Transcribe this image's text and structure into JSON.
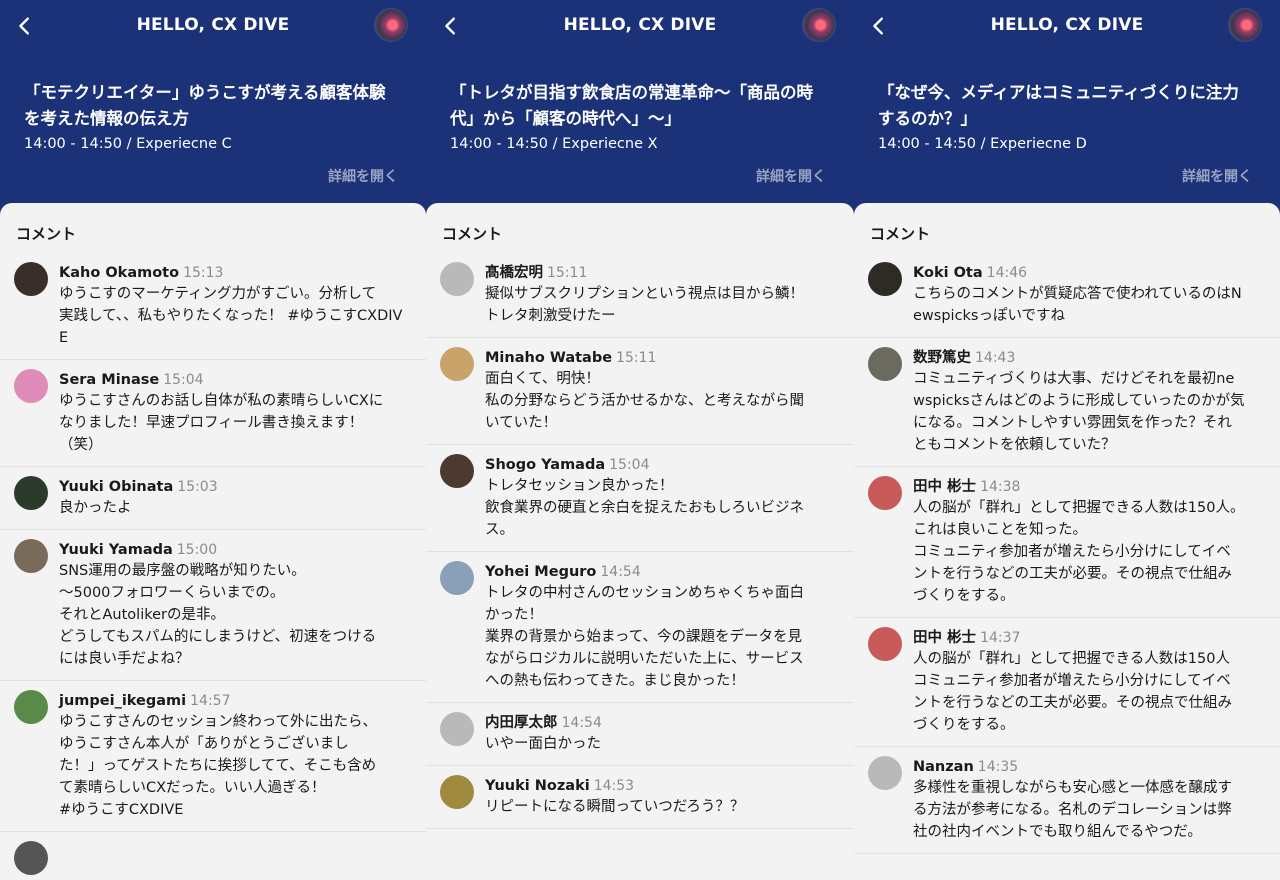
{
  "app": {
    "title": "HELLO, CX DIVE",
    "details_label": "詳細を開く",
    "comments_label": "コメント"
  },
  "panels": [
    {
      "session": {
        "title": "「モテクリエイター」ゆうこすが考える顧客体験を考えた情報の伝え方",
        "meta": "14:00 - 14:50 / Experiecne C"
      },
      "comments": [
        {
          "author": "Kaho Okamoto",
          "time": "15:13",
          "text": "ゆうこすのマーケティング力がすごい。分析して\n実践して、、私もやりたくなった！ #ゆうこすCXDIVE",
          "avatar": "#3a2e2a"
        },
        {
          "author": "Sera Minase",
          "time": "15:04",
          "text": "ゆうこすさんのお話し自体が私の素晴らしいCXに\nなりました！早速プロフィール書き換えます！\n（笑）",
          "avatar": "#e08bb8"
        },
        {
          "author": "Yuuki Obinata",
          "time": "15:03",
          "text": "良かったよ",
          "avatar": "#2b3b2b"
        },
        {
          "author": "Yuuki Yamada",
          "time": "15:00",
          "text": "SNS運用の最序盤の戦略が知りたい。\n〜5000フォロワーくらいまでの。\nそれとAutolikerの是非。\nどうしてもスパム的にしまうけど、初速をつける\nには良い手だよね？",
          "avatar": "#7a6a5a"
        },
        {
          "author": "jumpei_ikegami",
          "time": "14:57",
          "text": "ゆうこすさんのセッション終わって外に出たら、\nゆうこすさん本人が「ありがとうございまし\nた！」ってゲストたちに挨拶してて、そこも含め\nて素晴らしいCXだった。いい人過ぎる！\n#ゆうこすCXDIVE",
          "avatar": "#5a8a4a"
        },
        {
          "author": "",
          "time": "",
          "text": "",
          "avatar": "#555555"
        }
      ]
    },
    {
      "session": {
        "title": "「トレタが目指す飲食店の常連革命〜「商品の時代」から「顧客の時代へ」〜」",
        "meta": "14:00 - 14:50 / Experiecne X"
      },
      "comments": [
        {
          "author": "髙橋宏明",
          "time": "15:11",
          "text": "擬似サブスクリプションという視点は目から鱗！\nトレタ刺激受けたー",
          "avatar": "#b9b9b9"
        },
        {
          "author": "Minaho Watabe",
          "time": "15:11",
          "text": "面白くて、明快！\n私の分野ならどう活かせるかな、と考えながら聞\nいていた！",
          "avatar": "#c9a46a"
        },
        {
          "author": "Shogo Yamada",
          "time": "15:04",
          "text": "トレタセッション良かった！\n飲食業界の硬直と余白を捉えたおもしろいビジネ\nス。",
          "avatar": "#4a3a30"
        },
        {
          "author": "Yohei Meguro",
          "time": "14:54",
          "text": "トレタの中村さんのセッションめちゃくちゃ面白\nかった！\n業界の背景から始まって、今の課題をデータを見\nながらロジカルに説明いただいた上に、サービス\nへの熱も伝わってきた。まじ良かった！",
          "avatar": "#8aa0b8"
        },
        {
          "author": "内田厚太郎",
          "time": "14:54",
          "text": "いやー面白かった",
          "avatar": "#b9b9b9"
        },
        {
          "author": "Yuuki Nozaki",
          "time": "14:53",
          "text": "リピートになる瞬間っていつだろう？？",
          "avatar": "#a08a40"
        }
      ]
    },
    {
      "session": {
        "title": "「なぜ今、メディアはコミュニティづくりに注力するのか？」",
        "meta": "14:00 - 14:50 / Experiecne D"
      },
      "comments": [
        {
          "author": "Koki Ota",
          "time": "14:46",
          "text": "こちらのコメントが質疑応答で使われているのはN\newspicksっぽいですね",
          "avatar": "#2e2a26"
        },
        {
          "author": "数野篤史",
          "time": "14:43",
          "text": "コミュニティづくりは大事、だけどそれを最初ne\nwspicksさんはどのように形成していったのかが気\nになる。コメントしやすい雰囲気を作った？それ\nともコメントを依頼していた？",
          "avatar": "#6a6a60"
        },
        {
          "author": "田中 彬士",
          "time": "14:38",
          "text": "人の脳が「群れ」として把握できる人数は150人。\nこれは良いことを知った。\nコミュニティ参加者が増えたら小分けにしてイベ\nントを行うなどの工夫が必要。その視点で仕組み\nづくりをする。",
          "avatar": "#c85a5a"
        },
        {
          "author": "田中 彬士",
          "time": "14:37",
          "text": "人の脳が「群れ」として把握できる人数は150人\nコミュニティ参加者が増えたら小分けにしてイベ\nントを行うなどの工夫が必要。その視点で仕組み\nづくりをする。",
          "avatar": "#c85a5a"
        },
        {
          "author": "Nanzan",
          "time": "14:35",
          "text": "多様性を重視しながらも安心感と一体感を醸成す\nる方法が参考になる。名札のデコレーションは弊\n社の社内イベントでも取り組んでるやつだ。",
          "avatar": "#b9b9b9"
        }
      ]
    }
  ]
}
